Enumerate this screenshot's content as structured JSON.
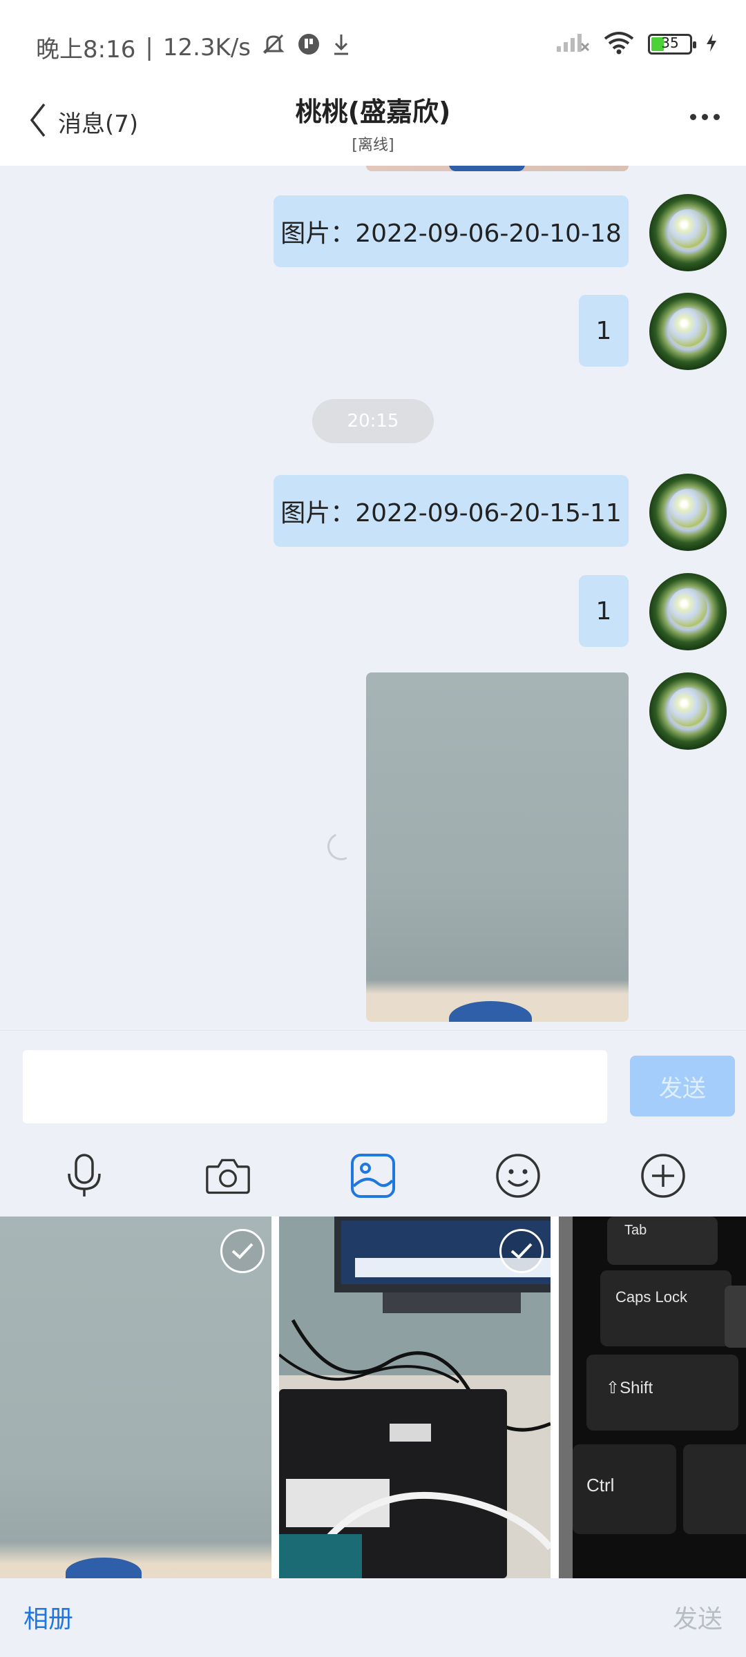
{
  "status_bar": {
    "time": "晚上8:16",
    "speed": "12.3K/s",
    "battery": "35"
  },
  "header": {
    "back_label": "消息(7)",
    "title": "桃桃(盛嘉欣)",
    "subtitle": "[离线]"
  },
  "messages": [
    {
      "type": "text",
      "text": "图片：2022-09-06-20-10-18"
    },
    {
      "type": "text",
      "text": "1"
    },
    {
      "type": "time",
      "text": "20:15"
    },
    {
      "type": "text",
      "text": "图片：2022-09-06-20-15-11"
    },
    {
      "type": "text",
      "text": "1"
    },
    {
      "type": "image",
      "text": ""
    }
  ],
  "composer": {
    "placeholder": "",
    "send_label": "发送"
  },
  "toolbar": [
    "microphone-icon",
    "camera-icon",
    "image-icon",
    "emoji-icon",
    "plus-icon"
  ],
  "gallery": {
    "album_label": "相册",
    "send_label": "发送"
  },
  "colors": {
    "bubble": "#c8e2f9",
    "accent": "#1e78e0",
    "send_disabled": "#a5cdfb"
  }
}
